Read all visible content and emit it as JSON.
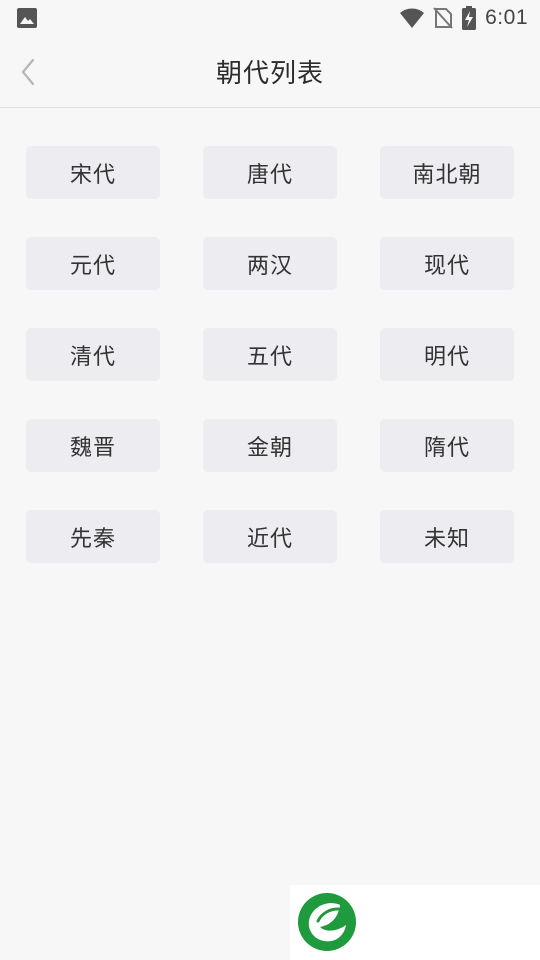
{
  "status_bar": {
    "time": "6:01",
    "icons": [
      "image-notification-icon",
      "wifi-icon",
      "no-sim-icon",
      "battery-charging-icon"
    ]
  },
  "header": {
    "title": "朝代列表",
    "back_icon": "chevron-left-icon"
  },
  "dynasties": [
    {
      "label": "宋代"
    },
    {
      "label": "唐代"
    },
    {
      "label": "南北朝"
    },
    {
      "label": "元代"
    },
    {
      "label": "两汉"
    },
    {
      "label": "现代"
    },
    {
      "label": "清代"
    },
    {
      "label": "五代"
    },
    {
      "label": "明代"
    },
    {
      "label": "魏晋"
    },
    {
      "label": "金朝"
    },
    {
      "label": "隋代"
    },
    {
      "label": "先秦"
    },
    {
      "label": "近代"
    },
    {
      "label": "未知"
    }
  ],
  "ad": {
    "logo_icon": "leaf-logo-icon",
    "logo_color": "#1f9a3c"
  },
  "colors": {
    "background": "#f7f7f7",
    "chip_background": "#ececf1",
    "text": "#333333"
  }
}
